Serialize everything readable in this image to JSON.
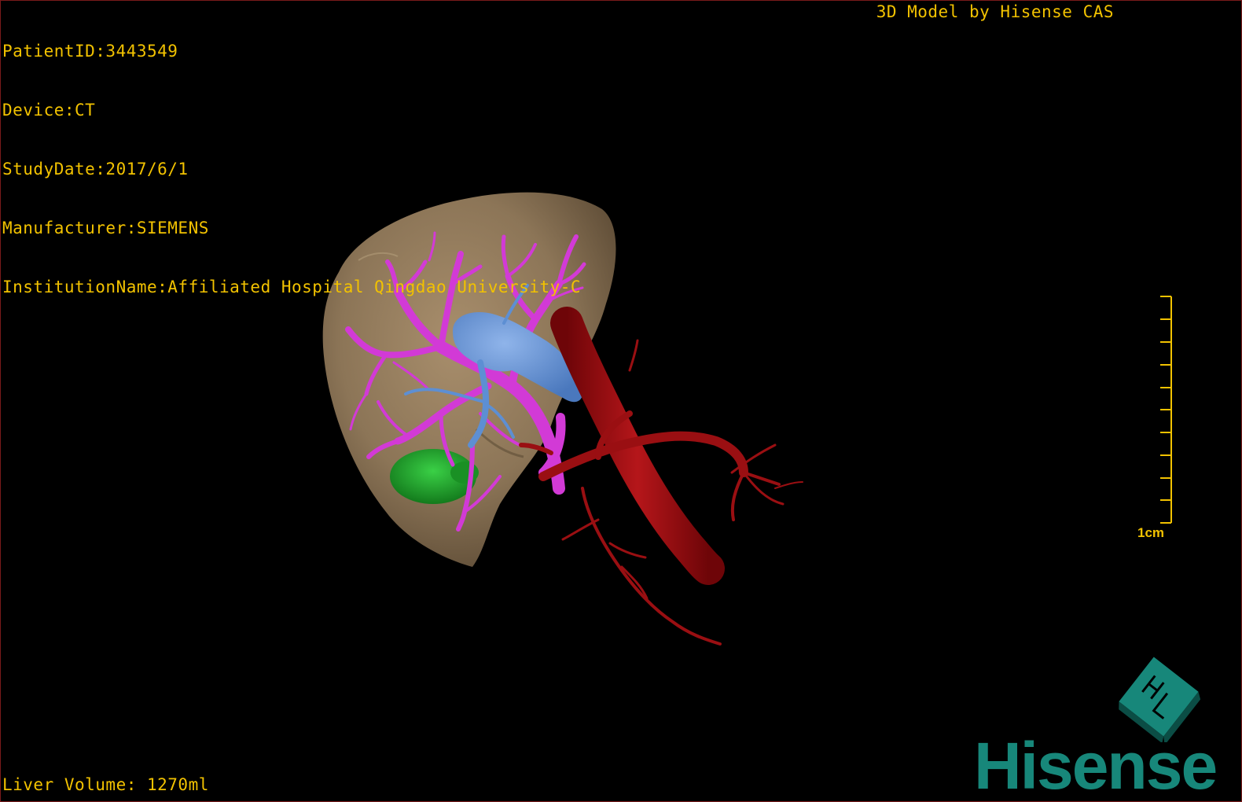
{
  "study_info": {
    "patient_id": "PatientID:3443549",
    "device": "Device:CT",
    "study_date": "StudyDate:2017/6/1",
    "manufacturer": "Manufacturer:SIEMENS",
    "institution": "InstitutionName:Affiliated Hospital Qingdao University-C"
  },
  "model_credit": "3D Model by Hisense CAS",
  "liver_volume": "Liver Volume: 1270ml",
  "scale_bar": {
    "label": "1cm"
  },
  "brand": {
    "name": "Hisense",
    "color": "#17877a"
  },
  "colors": {
    "overlay_text": "#f2c200",
    "liver": "#8c7557",
    "portal_vein": "#d23ad6",
    "hepatic_vein": "#5d8fd3",
    "artery": "#9a0f12",
    "lesion": "#1fa02a"
  },
  "structures": [
    "liver",
    "portal-vein",
    "hepatic-vein",
    "artery",
    "lesion"
  ]
}
